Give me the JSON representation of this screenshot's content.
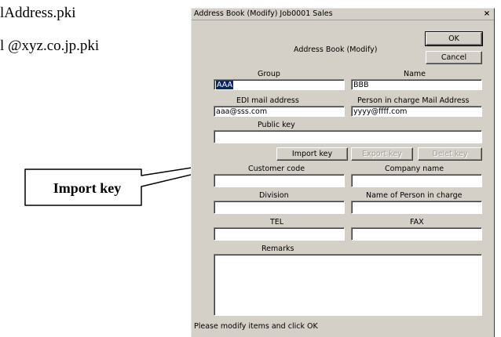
{
  "background": {
    "line1": "lAddress.pki",
    "line2": "l @xyz.co.jp.pki"
  },
  "callout": {
    "label": "Import key"
  },
  "window": {
    "title": "Address Book (Modify) Job0001 Sales",
    "close_label": "×",
    "heading": "Address Book (Modify)",
    "ok_label": "OK",
    "cancel_label": "Cancel",
    "status_text": "Please modify items and click OK"
  },
  "form": {
    "group": {
      "label": "Group",
      "value": "AAA"
    },
    "name": {
      "label": "Name",
      "value": "BBB"
    },
    "edi_mail": {
      "label": "EDI mail address",
      "value": "aaa@sss.com"
    },
    "person_mail": {
      "label": "Person in charge Mail Address",
      "value": "yyyy@ffff.com"
    },
    "public_key": {
      "label": "Public key",
      "value": ""
    },
    "customer_code": {
      "label": "Customer code",
      "value": ""
    },
    "company_name": {
      "label": "Company name",
      "value": ""
    },
    "division": {
      "label": "Division",
      "value": ""
    },
    "person_name": {
      "label": "Name of Person in charge",
      "value": ""
    },
    "tel": {
      "label": "TEL",
      "value": ""
    },
    "fax": {
      "label": "FAX",
      "value": ""
    },
    "remarks": {
      "label": "Remarks",
      "value": ""
    }
  },
  "key_buttons": {
    "import_label": "Import key",
    "export_label": "Export key",
    "delete_label": "Delet key"
  }
}
